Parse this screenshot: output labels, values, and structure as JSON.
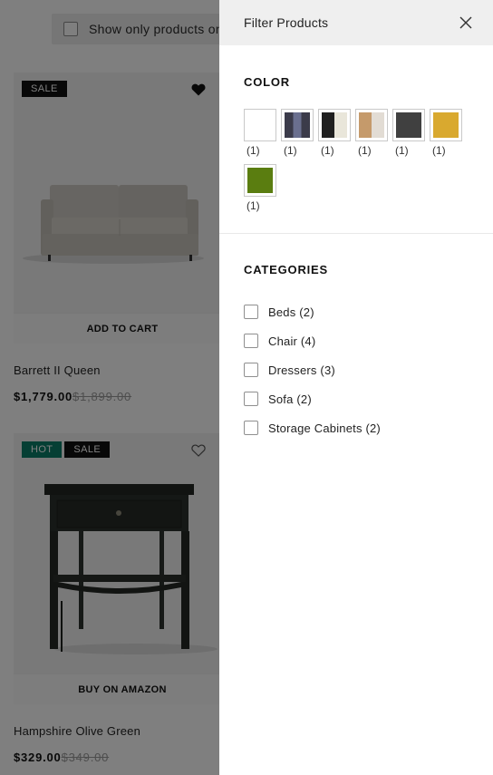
{
  "background": {
    "only_filter_label": "Show only products on",
    "products": [
      {
        "badges": [
          "SALE"
        ],
        "badge_types": [
          "sale"
        ],
        "wishlisted": true,
        "cta": "ADD TO CART",
        "name": "Barrett II Queen",
        "price": "$1,779.00",
        "old_price": "$1,899.00"
      },
      {
        "badges": [
          "HOT",
          "SALE"
        ],
        "badge_types": [
          "hot",
          "sale"
        ],
        "wishlisted": false,
        "cta": "BUY ON AMAZON",
        "name": "Hampshire Olive Green",
        "price": "$329.00",
        "old_price": "$349.00"
      }
    ]
  },
  "drawer": {
    "title": "Filter Products",
    "color": {
      "heading": "COLOR",
      "swatches": [
        {
          "count": "(1)",
          "colors": [
            "#ffffff"
          ]
        },
        {
          "count": "(1)",
          "colors": [
            "#3b3b4a",
            "#6a6f8f",
            "#3b3b4a"
          ]
        },
        {
          "count": "(1)",
          "colors": [
            "#202020",
            "#e9e6da"
          ]
        },
        {
          "count": "(1)",
          "colors": [
            "#c59a6b",
            "#e2dcd4"
          ]
        },
        {
          "count": "(1)",
          "colors": [
            "#404040"
          ]
        },
        {
          "count": "(1)",
          "colors": [
            "#d9a92f"
          ]
        },
        {
          "count": "(1)",
          "colors": [
            "#5a7d10"
          ]
        }
      ]
    },
    "categories": {
      "heading": "CATEGORIES",
      "items": [
        {
          "label": "Beds (2)"
        },
        {
          "label": "Chair (4)"
        },
        {
          "label": "Dressers (3)"
        },
        {
          "label": "Sofa (2)"
        },
        {
          "label": "Storage Cabinets (2)"
        }
      ]
    }
  }
}
